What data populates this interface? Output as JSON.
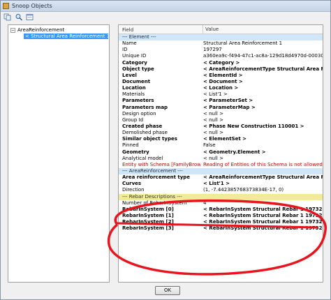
{
  "window": {
    "title": "Snoop Objects"
  },
  "toolbar": {
    "buttons": [
      "copy-icon",
      "search-icon",
      "inspect-icon"
    ]
  },
  "tree": {
    "root_label": "AreaReinforcement",
    "root_toggle": "−",
    "child_label": "< Structural Area Reinforcement 1  197297"
  },
  "grid": {
    "header": {
      "field": "Field",
      "value": "Value"
    },
    "rows": [
      {
        "type": "section",
        "field": "--- Element ---",
        "value": ""
      },
      {
        "type": "normal",
        "field": "Name",
        "value": "Structural Area Reinforcement 1"
      },
      {
        "type": "normal",
        "field": "ID",
        "value": "197297"
      },
      {
        "type": "normal",
        "field": "Unique ID",
        "value": "a360ea9c-f494-47c1-ac8a-129d18d4970d-000302b1"
      },
      {
        "type": "bold",
        "field": "Category",
        "value": "< Category >"
      },
      {
        "type": "bold",
        "field": "Object type",
        "value": "< AreaReinforcementType  Structural Area Reinfo"
      },
      {
        "type": "bold",
        "field": "Level",
        "value": "< ElementId >"
      },
      {
        "type": "bold",
        "field": "Document",
        "value": "< Document >"
      },
      {
        "type": "bold",
        "field": "Location",
        "value": "< Location >"
      },
      {
        "type": "normal",
        "field": "Materials",
        "value": "< List'1 >"
      },
      {
        "type": "bold",
        "field": "Parameters",
        "value": "< ParameterSet >"
      },
      {
        "type": "bold",
        "field": "Parameters map",
        "value": "< ParameterMap >"
      },
      {
        "type": "normal",
        "field": "Design option",
        "value": "< null >"
      },
      {
        "type": "normal",
        "field": "Group Id",
        "value": "< null >"
      },
      {
        "type": "bold",
        "field": "Created phase",
        "value": "< Phase  New Construction  110001 >"
      },
      {
        "type": "normal",
        "field": "Demolished phase",
        "value": "< null >"
      },
      {
        "type": "bold",
        "field": "Similar object types",
        "value": "< ElementSet >"
      },
      {
        "type": "normal",
        "field": "Pinned",
        "value": "False"
      },
      {
        "type": "bold",
        "field": "Geometry",
        "value": "< Geometry.Element >"
      },
      {
        "type": "normal",
        "field": "Analytical model",
        "value": "< null >"
      },
      {
        "type": "red",
        "field": "Entity with Schema [FamilyBrowserStat...",
        "value": "Reading of Entities of this Schema is not allowed to the cur..."
      },
      {
        "type": "section",
        "field": "--- AreaReinforcement ---",
        "value": ""
      },
      {
        "type": "bold",
        "field": "Area reinforcement type",
        "value": "< AreaReinforcementType  Structural Area Reinfo"
      },
      {
        "type": "bold",
        "field": "Curves",
        "value": "< List'1 >"
      },
      {
        "type": "normal",
        "field": "Direction",
        "value": "(1, -7.442385768373834E-17, 0)"
      },
      {
        "type": "section-yellow",
        "field": "--- Rebar Descriptions ---",
        "value": ""
      },
      {
        "type": "normal",
        "field": "Number of RebarInSystem",
        "value": "4"
      },
      {
        "type": "bold",
        "field": "RebarInSystem [0]",
        "value": "< RebarInSystem  Structural Rebar 1  197321 >"
      },
      {
        "type": "bold",
        "field": "RebarInSystem [1]",
        "value": "< RebarInSystem  Structural Rebar 1  197322 >"
      },
      {
        "type": "bold",
        "field": "RebarInSystem [2]",
        "value": "< RebarInSystem  Structural Rebar 1  197323 >"
      },
      {
        "type": "bold",
        "field": "RebarInSystem [3]",
        "value": "< RebarInSystem  Structural Rebar 1  197324 >"
      }
    ]
  },
  "footer": {
    "ok_label": "OK"
  },
  "annotation": {
    "color": "#e8141e"
  }
}
